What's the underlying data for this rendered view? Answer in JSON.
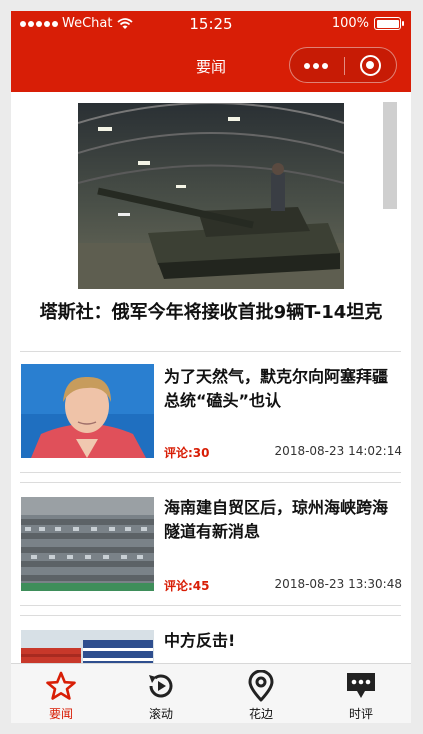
{
  "status_bar": {
    "carrier": "WeChat",
    "time": "15:25",
    "battery": "100%"
  },
  "nav": {
    "title": "要闻"
  },
  "hero": {
    "title": "塔斯社：俄军今年将接收首批9辆T-14坦克"
  },
  "news": [
    {
      "title": "为了天然气，默克尔向阿塞拜疆总统“磕头”也认",
      "comments": "评论:30",
      "date": "2018-08-23 14:02:14"
    },
    {
      "title": "海南建自贸区后，琼州海峡跨海隧道有新消息",
      "comments": "评论:45",
      "date": "2018-08-23 13:30:48"
    },
    {
      "title": "中方反击!",
      "comments": "",
      "date": ""
    }
  ],
  "tabs": [
    {
      "label": "要闻",
      "icon": "star-icon",
      "active": true
    },
    {
      "label": "滚动",
      "icon": "refresh-icon",
      "active": false
    },
    {
      "label": "花边",
      "icon": "location-pin-icon",
      "active": false
    },
    {
      "label": "时评",
      "icon": "chat-bubble-icon",
      "active": false
    }
  ],
  "colors": {
    "brand": "#d81e06",
    "accent_text": "#d81e06"
  }
}
